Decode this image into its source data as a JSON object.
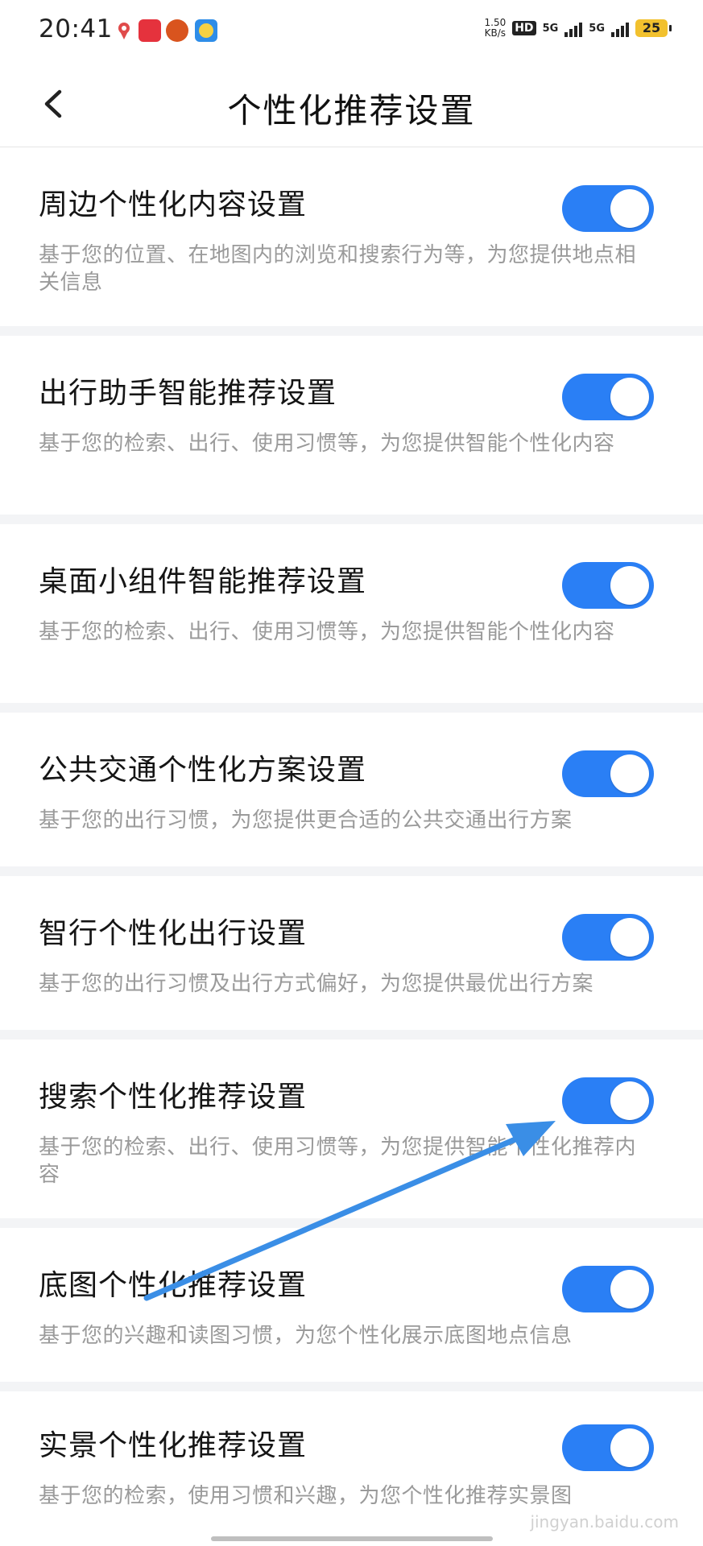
{
  "status_bar": {
    "time": "20:41",
    "speed_top": "1.50",
    "speed_bottom": "KB/s",
    "hd_label": "HD",
    "network_1": "5G",
    "network_2": "5G",
    "battery": "25",
    "app_icons": [
      "location-pin-icon",
      "news-app-icon",
      "game-app-icon",
      "assistant-app-icon"
    ]
  },
  "header": {
    "title": "个性化推荐设置",
    "back_icon": "chevron-left-icon"
  },
  "settings": [
    {
      "title": "周边个性化内容设置",
      "desc": "基于您的位置、在地图内的浏览和搜索行为等，为您提供地点相关信息",
      "enabled": true
    },
    {
      "title": "出行助手智能推荐设置",
      "desc": "基于您的检索、出行、使用习惯等，为您提供智能个性化内容",
      "enabled": true
    },
    {
      "title": "桌面小组件智能推荐设置",
      "desc": "基于您的检索、出行、使用习惯等，为您提供智能个性化内容",
      "enabled": true
    },
    {
      "title": "公共交通个性化方案设置",
      "desc": "基于您的出行习惯，为您提供更合适的公共交通出行方案",
      "enabled": true
    },
    {
      "title": "智行个性化出行设置",
      "desc": "基于您的出行习惯及出行方式偏好，为您提供最优出行方案",
      "enabled": true
    },
    {
      "title": "搜索个性化推荐设置",
      "desc": "基于您的检索、出行、使用习惯等，为您提供智能个性化推荐内容",
      "enabled": true
    },
    {
      "title": "底图个性化推荐设置",
      "desc": "基于您的兴趣和读图习惯，为您个性化展示底图地点信息",
      "enabled": true
    },
    {
      "title": "实景个性化推荐设置",
      "desc": "基于您的检索，使用习惯和兴趣，为您个性化推荐实景图",
      "enabled": true
    }
  ],
  "watermark": "jingyan.baidu.com",
  "colors": {
    "toggle_on": "#2a7ff5",
    "annotation_arrow": "#3a8ee6"
  }
}
